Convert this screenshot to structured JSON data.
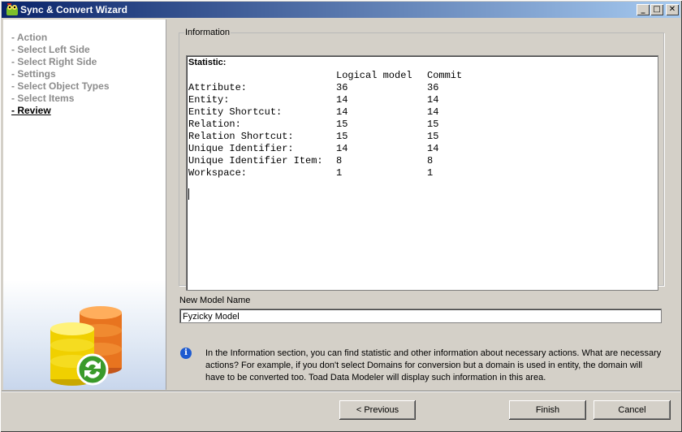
{
  "window": {
    "title": "Sync & Convert Wizard"
  },
  "titlebar_buttons": {
    "minimize": "_",
    "maximize": "□",
    "close": "✕"
  },
  "steps": [
    {
      "label": "- Action"
    },
    {
      "label": "- Select Left Side"
    },
    {
      "label": "- Select Right Side"
    },
    {
      "label": "- Settings"
    },
    {
      "label": "- Select Object Types"
    },
    {
      "label": "- Select Items"
    },
    {
      "label": "- Review"
    }
  ],
  "current_step": "- Review",
  "information": {
    "legend": "Information",
    "heading": "Statistic:",
    "columns": [
      "",
      "Logical model",
      "Commit"
    ],
    "rows": [
      [
        "Attribute:",
        "36",
        "36"
      ],
      [
        "Entity:",
        "14",
        "14"
      ],
      [
        "Entity Shortcut:",
        "14",
        "14"
      ],
      [
        "Relation:",
        "15",
        "15"
      ],
      [
        "Relation Shortcut:",
        "15",
        "15"
      ],
      [
        "Unique Identifier:",
        "14",
        "14"
      ],
      [
        "Unique Identifier Item:",
        "8",
        "8"
      ],
      [
        "Workspace:",
        "1",
        "1"
      ]
    ]
  },
  "model_name": {
    "label": "New Model Name",
    "value": "Fyzicky Model"
  },
  "help": {
    "icon": "info-icon",
    "text": "In the Information section, you can find statistic and other information about necessary actions. What are necessary actions? For example, if you don't select Domains for conversion but a domain is used in entity, the domain will have to be converted too. Toad Data Modeler will display such information in this area."
  },
  "buttons": {
    "previous": "< Previous",
    "finish": "Finish",
    "cancel": "Cancel"
  },
  "colors": {
    "title_start": "#0a246a",
    "title_end": "#a6caf0",
    "current_step": "#000000",
    "inactive_step": "#8c8c8c"
  }
}
